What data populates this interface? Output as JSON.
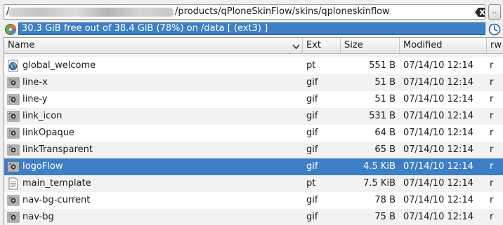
{
  "path": {
    "lead": "/",
    "visible_text": "/products/qPloneSkinFlow/skins/qploneskinflow",
    "more_button": ".."
  },
  "freespace": {
    "text": "30.3 GiB free out of 38.4 GiB (78%) on /data [ (ext3) ]"
  },
  "columns": {
    "name": "Name",
    "ext": "Ext",
    "size": "Size",
    "modified": "Modified",
    "rw": "rw"
  },
  "files": [
    {
      "name": "global_welcome",
      "ext": "pt",
      "size": "551 B",
      "modified": "07/14/10 12:14",
      "rw": "r",
      "icon": "web-page-icon"
    },
    {
      "name": "line-x",
      "ext": "gif",
      "size": "51 B",
      "modified": "07/14/10 12:14",
      "rw": "r",
      "icon": "image-icon"
    },
    {
      "name": "line-y",
      "ext": "gif",
      "size": "51 B",
      "modified": "07/14/10 12:14",
      "rw": "r",
      "icon": "image-icon"
    },
    {
      "name": "link_icon",
      "ext": "gif",
      "size": "531 B",
      "modified": "07/14/10 12:14",
      "rw": "r",
      "icon": "image-icon"
    },
    {
      "name": "linkOpaque",
      "ext": "gif",
      "size": "64 B",
      "modified": "07/14/10 12:14",
      "rw": "r",
      "icon": "image-icon"
    },
    {
      "name": "linkTransparent",
      "ext": "gif",
      "size": "65 B",
      "modified": "07/14/10 12:14",
      "rw": "r",
      "icon": "image-icon"
    },
    {
      "name": "logoFlow",
      "ext": "gif",
      "size": "4.5 KiB",
      "modified": "07/14/10 12:14",
      "rw": "r",
      "icon": "image-icon",
      "selected": true
    },
    {
      "name": "main_template",
      "ext": "pt",
      "size": "7.5 KiB",
      "modified": "07/14/10 12:14",
      "rw": "r",
      "icon": "text-document-icon"
    },
    {
      "name": "nav-bg-current",
      "ext": "gif",
      "size": "78 B",
      "modified": "07/14/10 12:14",
      "rw": "r",
      "icon": "image-icon"
    },
    {
      "name": "nav-bg",
      "ext": "gif",
      "size": "75 B",
      "modified": "07/14/10 12:14",
      "rw": "r",
      "icon": "image-icon"
    }
  ],
  "colors": {
    "selection": "#3d7fc7",
    "row_alt": "#f2f2f2",
    "window_bg": "#efefef"
  }
}
